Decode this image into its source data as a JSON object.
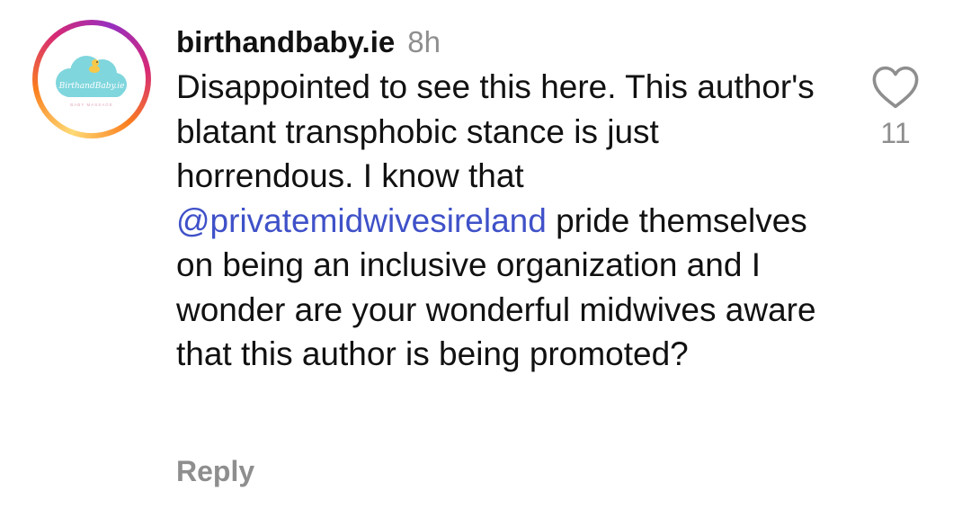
{
  "comment": {
    "avatar": {
      "icon": "brand-logo-icon",
      "logo_text": "BirthandBaby.ie",
      "logo_subtext": "BABY MASSAGE"
    },
    "username": "birthandbaby.ie",
    "time": "8h",
    "text_before_mention": "Disappointed to see this here. This author's blatant transphobic stance is just horrendous. I know that ",
    "mention": "@privatemidwivesireland",
    "text_after_mention": " pride themselves on being an inclusive organization and I wonder are your wonderful midwives aware that this author is being promoted?",
    "reply_label": "Reply",
    "like_icon": "heart-outline-icon",
    "like_count": "11"
  },
  "colors": {
    "mention": "#3f51c8",
    "muted": "#8e8e8e",
    "text": "#111111",
    "avatar_cloud": "#7fd6dd",
    "avatar_ring": [
      "#feda75",
      "#fa7e1e",
      "#d62976",
      "#962fbf"
    ]
  }
}
